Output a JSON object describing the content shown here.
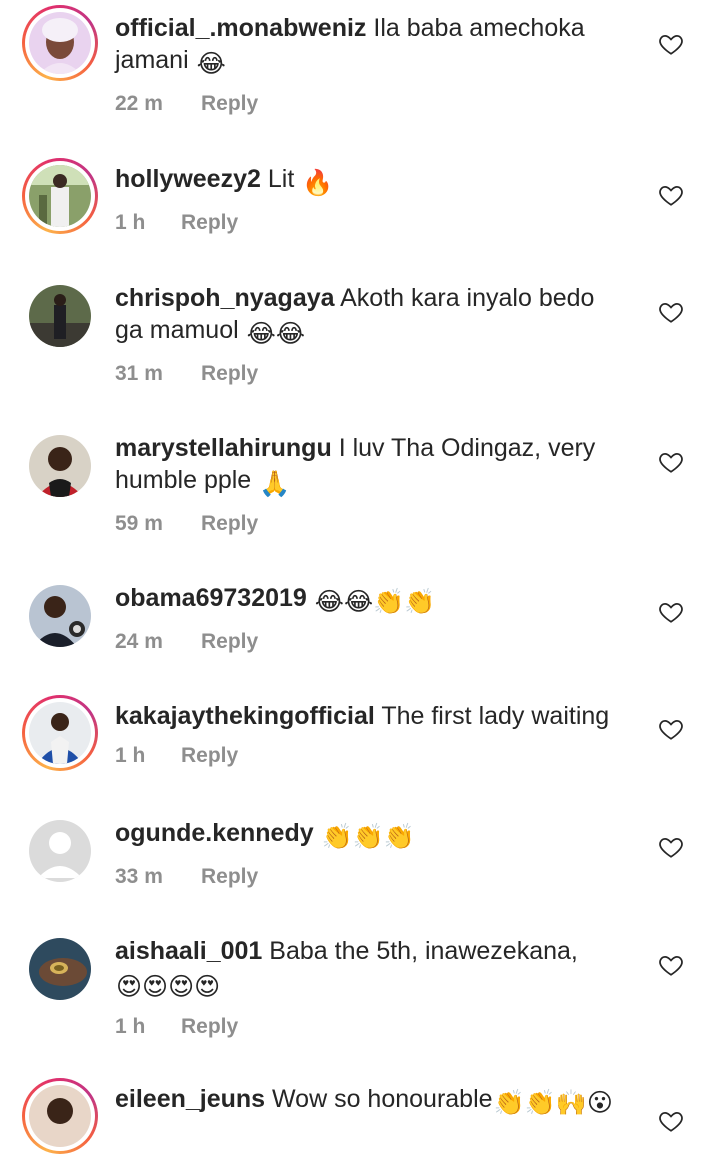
{
  "comments": [
    {
      "username": "official_.monabweniz",
      "text": "Ila baba amechoka",
      "text2": "jamani",
      "emojis": "😂",
      "time": "22 m",
      "reply": "Reply"
    },
    {
      "username": "hollyweezy2",
      "text": "Lit",
      "emojis": "🔥",
      "time": "1 h",
      "reply": "Reply"
    },
    {
      "username": "chrispoh_nyagaya",
      "text": "Akoth kara inyalo bedo",
      "text2": "ga mamuol",
      "emojis": "😂😂",
      "time": "31 m",
      "reply": "Reply"
    },
    {
      "username": "marystellahirungu",
      "text": "I luv Tha Odingaz, very",
      "text2": "humble pple",
      "emojis": "🙏",
      "time": "59 m",
      "reply": "Reply"
    },
    {
      "username": "obama69732019",
      "text": "",
      "emojis": "😂😂👏👏",
      "time": "24 m",
      "reply": "Reply"
    },
    {
      "username": "kakajaythekingofficial",
      "text": "The first lady waiting",
      "time": "1 h",
      "reply": "Reply"
    },
    {
      "username": "ogunde.kennedy",
      "text": "",
      "emojis": "👏👏👏",
      "time": "33 m",
      "reply": "Reply"
    },
    {
      "username": "aishaali_001",
      "text": "Baba the 5th, inawezekana,",
      "text2": "",
      "emojis2": "😍😍😍😍",
      "time": "1 h",
      "reply": "Reply"
    },
    {
      "username": "eileen_jeuns",
      "text": "Wow so honourable",
      "emojis": "👏👏🙌😮"
    }
  ],
  "icons": {
    "like": "heart-outline-icon"
  }
}
